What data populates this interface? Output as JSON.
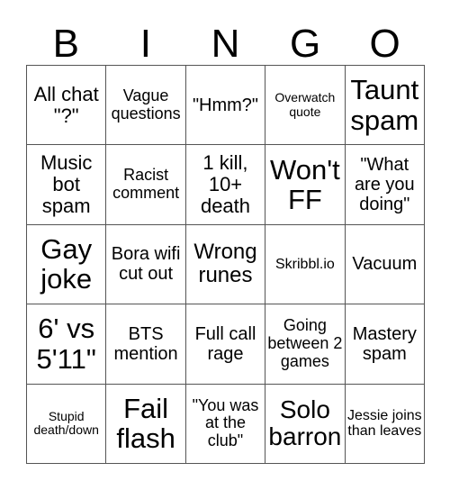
{
  "header": {
    "letters": [
      "B",
      "I",
      "N",
      "G",
      "O"
    ]
  },
  "cells": [
    [
      "All chat \"?\"",
      "Vague questions",
      "\"Hmm?\"",
      "Overwatch quote",
      "Taunt spam"
    ],
    [
      "Music bot spam",
      "Racist comment",
      "1 kill, 10+ death",
      "Won't FF",
      "\"What are you doing\""
    ],
    [
      "Gay joke",
      "Bora wifi cut out",
      "Wrong runes",
      "Skribbl.io",
      "Vacuum"
    ],
    [
      "6' vs 5'11\"",
      "BTS mention",
      "Full call rage",
      "Going between 2 games",
      "Mastery spam"
    ],
    [
      "Stupid death/down",
      "Fail flash",
      "\"You was at the club\"",
      "Solo barron",
      "Jessie joins than leaves"
    ]
  ]
}
